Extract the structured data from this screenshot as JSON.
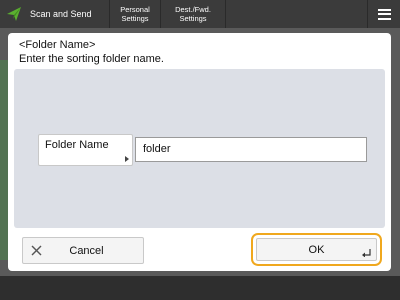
{
  "topbar": {
    "home_label": "Scan and Send",
    "personal_settings_label": "Personal\nSettings",
    "dest_fwd_label": "Dest./Fwd.\nSettings"
  },
  "dialog": {
    "title": "<Folder Name>",
    "subtitle": "Enter the sorting folder name.",
    "field_label": "Folder Name",
    "field_value": "folder",
    "cancel_label": "Cancel",
    "ok_label": "OK"
  },
  "colors": {
    "accent_green": "#5bb030",
    "ok_focus": "#f0a81e",
    "panel_bg": "#dcdfe6"
  },
  "icons": {
    "home": "send-icon",
    "menu": "menu-icon",
    "cancel": "close-icon",
    "ok": "enter-icon"
  }
}
